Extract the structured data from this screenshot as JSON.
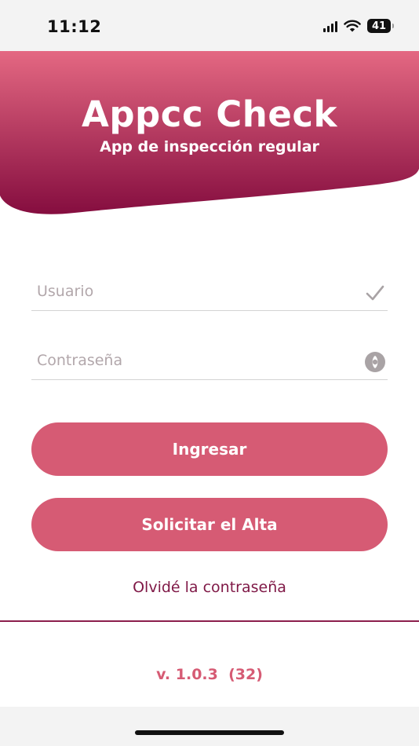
{
  "status_bar": {
    "time": "11:12",
    "battery": "41",
    "icons": [
      "signal-icon",
      "wifi-icon",
      "battery-icon"
    ]
  },
  "header": {
    "title": "Appcc Check",
    "subtitle": "App de inspección regular",
    "gradient_top": "#e46882",
    "gradient_bottom": "#850d3f"
  },
  "login": {
    "username_placeholder": "Usuario",
    "username_value": "",
    "username_icon": "check-icon",
    "password_placeholder": "Contraseña",
    "password_value": "",
    "password_icon": "eye-icon"
  },
  "buttons": {
    "login_label": "Ingresar",
    "signup_label": "Solicitar el Alta"
  },
  "forgot_password": "Olvidé la contraseña",
  "version": "v. 1.0.3  (32)",
  "colors": {
    "accent": "#d65b74",
    "link": "#7f1846",
    "divider": "#8c1f4c"
  }
}
